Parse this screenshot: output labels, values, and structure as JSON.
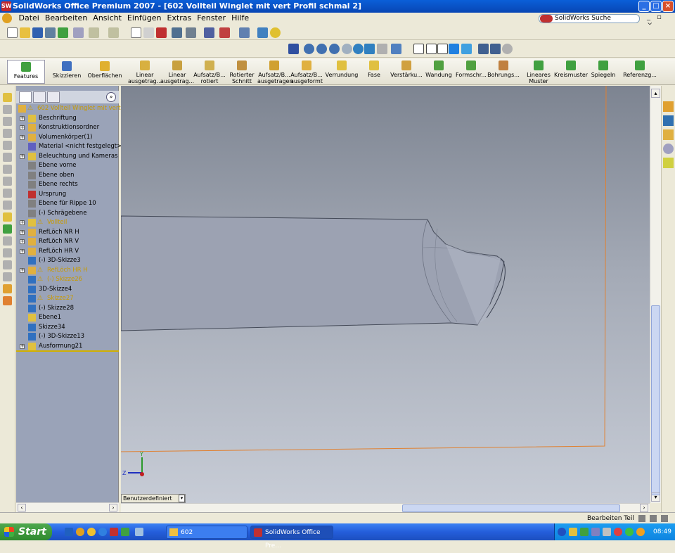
{
  "window": {
    "title": "SolidWorks Office Premium 2007 - [602 Vollteil Winglet mit vert Profil schmal 2]",
    "app_icon": "SW",
    "controls": {
      "minimize": "_",
      "maximize": "□",
      "close": "×"
    }
  },
  "menu": {
    "items": [
      "Datei",
      "Bearbeiten",
      "Ansicht",
      "Einfügen",
      "Extras",
      "Fenster",
      "Hilfe"
    ],
    "search_placeholder": "SolidWorks Suche"
  },
  "command_manager": {
    "left_tabs": [
      "Features",
      "Skizzieren",
      "Oberflächen"
    ],
    "buttons": [
      {
        "label1": "Linear",
        "label2": "ausgetrag...",
        "icon": "extrude-icon",
        "color": "#d8b040"
      },
      {
        "label1": "Linear",
        "label2": "ausgetrag...",
        "icon": "cut-extrude-icon",
        "color": "#c8a040"
      },
      {
        "label1": "Aufsatz/B...",
        "label2": "rotiert",
        "icon": "revolve-icon",
        "color": "#d0b050"
      },
      {
        "label1": "Rotierter",
        "label2": "Schnitt",
        "icon": "revolve-cut-icon",
        "color": "#c09040"
      },
      {
        "label1": "Aufsatz/B...",
        "label2": "ausgetragen",
        "icon": "sweep-icon",
        "color": "#d0a030"
      },
      {
        "label1": "Aufsatz/B...",
        "label2": "ausgeformt",
        "icon": "loft-icon",
        "color": "#e0b040"
      },
      {
        "label1": "Verrundung",
        "label2": "",
        "icon": "fillet-icon",
        "color": "#e0c040"
      },
      {
        "label1": "Fase",
        "label2": "",
        "icon": "chamfer-icon",
        "color": "#e0c040"
      },
      {
        "label1": "Verstärku...",
        "label2": "",
        "icon": "rib-icon",
        "color": "#d0a040"
      },
      {
        "label1": "Wandung",
        "label2": "",
        "icon": "shell-icon",
        "color": "#50a040"
      },
      {
        "label1": "Formschr...",
        "label2": "",
        "icon": "draft-icon",
        "color": "#50a040"
      },
      {
        "label1": "Bohrungs...",
        "label2": "",
        "icon": "hole-wizard-icon",
        "color": "#c08040"
      },
      {
        "label1": "Lineares",
        "label2": "Muster",
        "icon": "linear-pattern-icon",
        "color": "#40a040"
      },
      {
        "label1": "Kreismuster",
        "label2": "",
        "icon": "circular-pattern-icon",
        "color": "#40a040"
      },
      {
        "label1": "Spiegeln",
        "label2": "",
        "icon": "mirror-icon",
        "color": "#40a040"
      },
      {
        "label1": "Referenzg...",
        "label2": "",
        "icon": "reference-geometry-icon",
        "color": "#40a040"
      }
    ]
  },
  "feature_tree": {
    "root": "602 Vollteil Winglet mit vert Prof",
    "items": [
      {
        "label": "Beschriftung",
        "expand": "+",
        "warn": false,
        "icon": "annotations-icon",
        "color": "#e0c040"
      },
      {
        "label": "Konstruktionsordner",
        "expand": "+",
        "warn": false,
        "icon": "design-binder-icon",
        "color": "#e0b040"
      },
      {
        "label": "Volumenkörper(1)",
        "expand": "+",
        "warn": false,
        "icon": "solid-bodies-icon",
        "color": "#e0b040"
      },
      {
        "label": "Material <nicht festgelegt>",
        "expand": "",
        "warn": false,
        "icon": "material-icon",
        "color": "#6060c0"
      },
      {
        "label": "Beleuchtung und Kameras",
        "expand": "+",
        "warn": false,
        "icon": "lights-icon",
        "color": "#e0c040"
      },
      {
        "label": "Ebene vorne",
        "expand": "",
        "warn": false,
        "icon": "plane-icon",
        "color": "#808080"
      },
      {
        "label": "Ebene oben",
        "expand": "",
        "warn": false,
        "icon": "plane-icon",
        "color": "#808080"
      },
      {
        "label": "Ebene rechts",
        "expand": "",
        "warn": false,
        "icon": "plane-icon",
        "color": "#808080"
      },
      {
        "label": "Ursprung",
        "expand": "",
        "warn": false,
        "icon": "origin-icon",
        "color": "#c03030"
      },
      {
        "label": "Ebene für Rippe 10",
        "expand": "",
        "warn": false,
        "icon": "plane-icon",
        "color": "#808080"
      },
      {
        "label": "(-) Schrägebene",
        "expand": "",
        "warn": false,
        "icon": "plane-icon",
        "color": "#808080"
      },
      {
        "label": "Vollteil",
        "expand": "+",
        "warn": true,
        "icon": "loft-feature-icon",
        "color": "#e0c040"
      },
      {
        "label": "RefLöch NR H",
        "expand": "+",
        "warn": false,
        "icon": "cut-feature-icon",
        "color": "#e0b040"
      },
      {
        "label": "RefLöch NR V",
        "expand": "+",
        "warn": false,
        "icon": "cut-feature-icon",
        "color": "#e0b040"
      },
      {
        "label": "RefLöch HR V",
        "expand": "+",
        "warn": false,
        "icon": "cut-feature-icon",
        "color": "#e0b040"
      },
      {
        "label": "(-) 3D-Skizze3",
        "expand": "",
        "warn": false,
        "icon": "3d-sketch-icon",
        "color": "#3070c0"
      },
      {
        "label": "RefLöch HR H",
        "expand": "+",
        "warn": true,
        "icon": "cut-feature-icon",
        "color": "#e0b040"
      },
      {
        "label": "(-) Skizze26",
        "expand": "",
        "warn": true,
        "icon": "sketch-icon",
        "color": "#3070c0"
      },
      {
        "label": "3D-Skizze4",
        "expand": "",
        "warn": false,
        "icon": "3d-sketch-icon",
        "color": "#3070c0"
      },
      {
        "label": "Skizze27",
        "expand": "",
        "warn": true,
        "icon": "sketch-icon",
        "color": "#3070c0"
      },
      {
        "label": "(-) Skizze28",
        "expand": "",
        "warn": false,
        "icon": "sketch-icon",
        "color": "#3070c0"
      },
      {
        "label": "Ebene1",
        "expand": "",
        "warn": false,
        "icon": "plane-icon",
        "color": "#e0c040"
      },
      {
        "label": "Skizze34",
        "expand": "",
        "warn": false,
        "icon": "sketch-icon",
        "color": "#3070c0"
      },
      {
        "label": "(-) 3D-Skizze13",
        "expand": "",
        "warn": false,
        "icon": "3d-sketch-icon",
        "color": "#3070c0"
      },
      {
        "label": "Ausformung21",
        "expand": "+",
        "warn": false,
        "icon": "loft-feature-icon",
        "color": "#e0c040"
      }
    ]
  },
  "viewport": {
    "triad_y": "Y",
    "triad_z": "Z",
    "view_tab": "Benutzerdefiniert"
  },
  "status": {
    "text": "Bearbeiten Teil"
  },
  "taskbar": {
    "start": "Start",
    "tasks": [
      "602",
      "SolidWorks Office Pre..."
    ],
    "clock": "08:49"
  }
}
